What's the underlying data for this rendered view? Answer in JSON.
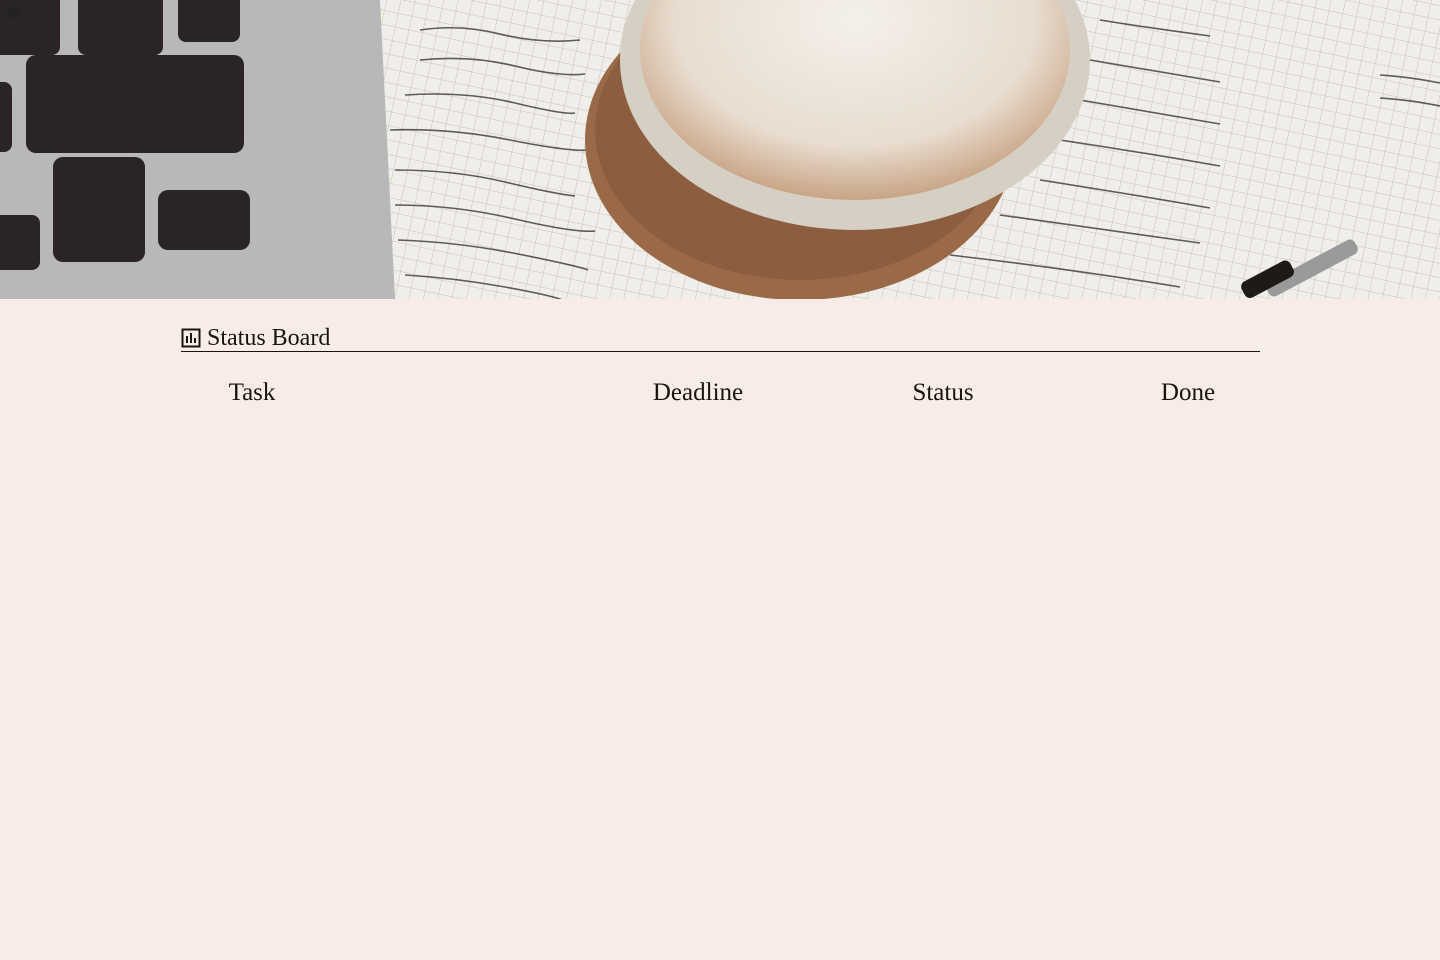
{
  "banner": {
    "image_alt": "Laptop keyboard, notebook with handwritten notes and a cappuccino on a cork coaster"
  },
  "corner_icon": "page-icon",
  "board": {
    "icon": "chart-icon",
    "title": "Status Board",
    "columns": [
      "Task",
      "Deadline",
      "Status",
      "Done"
    ]
  }
}
